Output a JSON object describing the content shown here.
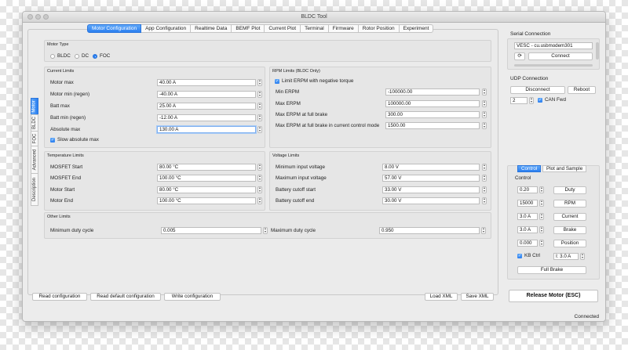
{
  "window": {
    "title": "BLDC Tool"
  },
  "tabs": [
    "Motor Configuration",
    "App Configuration",
    "Realtime Data",
    "BEMF Plot",
    "Current Plot",
    "Terminal",
    "Firmware",
    "Rotor Position",
    "Experiment"
  ],
  "side_tabs": [
    "Motor",
    "BLDC",
    "FOC",
    "Advanced",
    "Description"
  ],
  "motor_type": {
    "title": "Motor Type",
    "options": [
      "BLDC",
      "DC",
      "FOC"
    ],
    "selected": "FOC"
  },
  "current_limits": {
    "title": "Current Limits",
    "rows": [
      {
        "label": "Motor max",
        "value": "40.00 A"
      },
      {
        "label": "Motor min (regen)",
        "value": "-40.00 A"
      },
      {
        "label": "Batt max",
        "value": "25.00 A"
      },
      {
        "label": "Batt min (regen)",
        "value": "-12.00 A"
      },
      {
        "label": "Absolute max",
        "value": "130.00 A"
      }
    ],
    "slow_absolute_max": "Slow absolute max"
  },
  "rpm_limits": {
    "title": "RPM Limits (BLDC Only)",
    "limit_erpm": "Limit ERPM with negative torque",
    "rows": [
      {
        "label": "Min ERPM",
        "value": "-100000.00"
      },
      {
        "label": "Max ERPM",
        "value": "100000.00"
      },
      {
        "label": "Max ERPM at full brake",
        "value": "300.00"
      },
      {
        "label": "Max ERPM at full brake in current control mode",
        "value": "1500.00"
      }
    ]
  },
  "temperature_limits": {
    "title": "Temperature Limits",
    "rows": [
      {
        "label": "MOSFET Start",
        "value": "80.00 °C"
      },
      {
        "label": "MOSFET End",
        "value": "100.00 °C"
      },
      {
        "label": "Motor Start",
        "value": "80.00 °C"
      },
      {
        "label": "Motor End",
        "value": "100.00 °C"
      }
    ]
  },
  "voltage_limits": {
    "title": "Voltage Limits",
    "rows": [
      {
        "label": "Minimum input voltage",
        "value": "8.00 V"
      },
      {
        "label": "Maximum input voltage",
        "value": "57.00 V"
      },
      {
        "label": "Battery cutoff start",
        "value": "33.00 V"
      },
      {
        "label": "Battery cutoff end",
        "value": "30.00 V"
      }
    ]
  },
  "other_limits": {
    "title": "Other Limits",
    "min_duty_label": "Minimum duty cycle",
    "min_duty_value": "0.005",
    "max_duty_label": "Maximum duty cycle",
    "max_duty_value": "0.950"
  },
  "bottom_buttons": {
    "read_config": "Read configuration",
    "read_default": "Read default configuration",
    "write_config": "Write configuration",
    "load_xml": "Load XML",
    "save_xml": "Save XML"
  },
  "serial": {
    "title": "Serial Connection",
    "port": "VESC - cu.usbmodem301",
    "connect": "Connect",
    "refresh_icon": "refresh-icon"
  },
  "udp": {
    "title": "UDP Connection",
    "disconnect": "Disconnect",
    "reboot": "Reboot",
    "can_id": "2",
    "can_fwd": "CAN Fwd"
  },
  "control": {
    "tabs": [
      "Control",
      "Plot and Sample"
    ],
    "subtitle": "Control",
    "rows": [
      {
        "value": "0.20",
        "button": "Duty"
      },
      {
        "value": "15000",
        "button": "RPM"
      },
      {
        "value": "3.0 A",
        "button": "Current"
      },
      {
        "value": "3.0 A",
        "button": "Brake"
      },
      {
        "value": "0.000",
        "button": "Position"
      }
    ],
    "kb_ctrl": "KB Ctrl",
    "kb_value": "I: 3.0 A",
    "full_brake": "Full Brake",
    "release_motor": "Release Motor (ESC)"
  },
  "status": "Connected",
  "colors": {
    "accent": "#2b7ff0",
    "window_bg": "#ececec"
  }
}
